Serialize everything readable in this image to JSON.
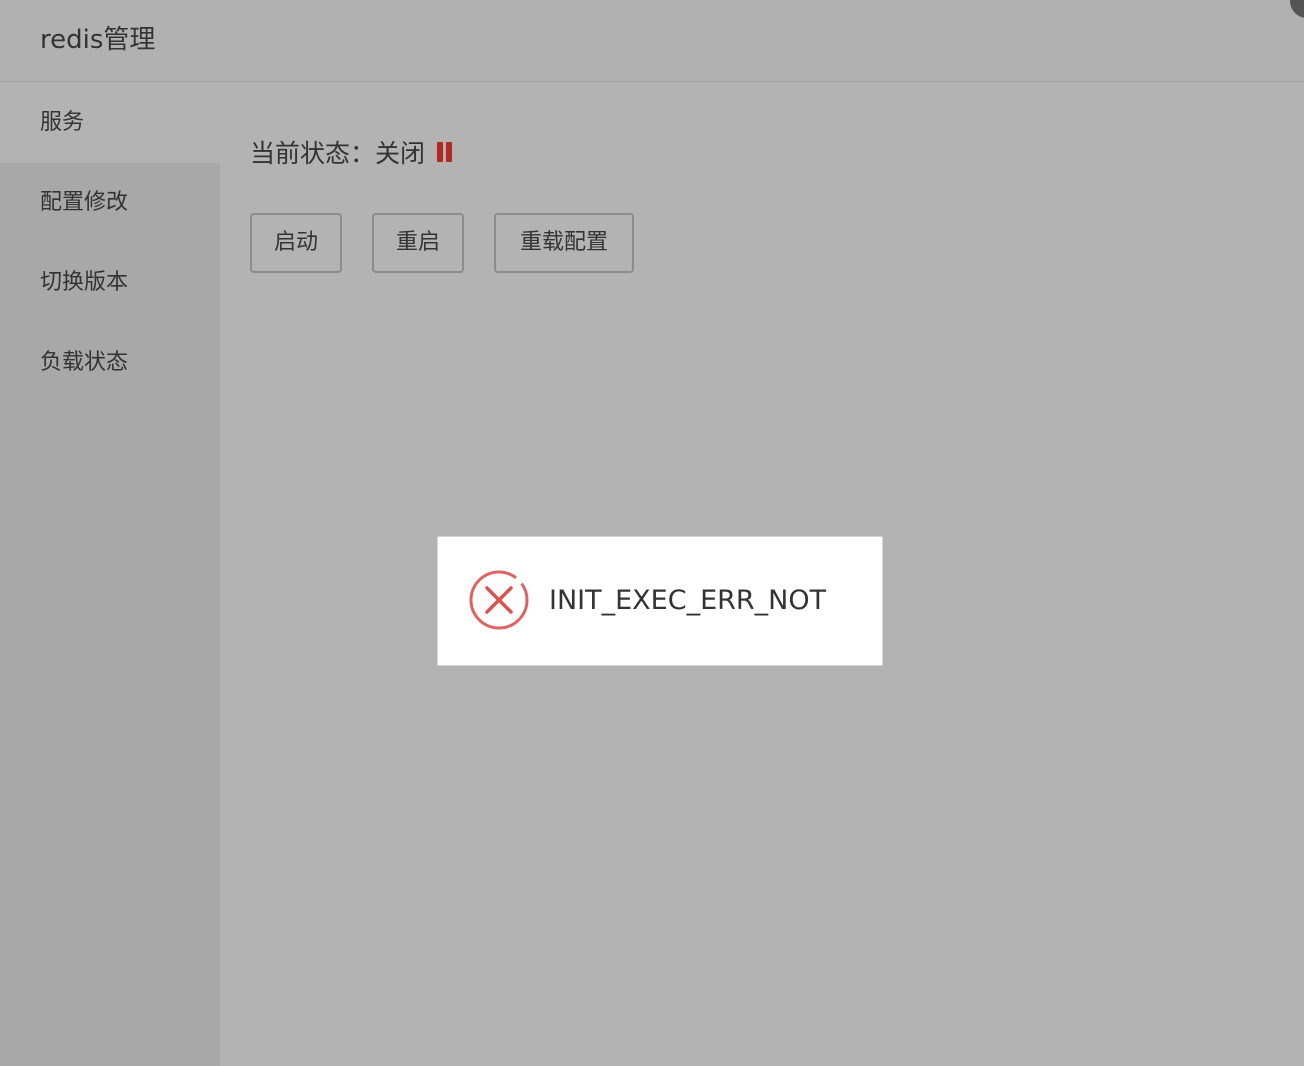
{
  "app": {
    "title": "redis管理"
  },
  "sidebar": {
    "items": [
      {
        "label": "服务",
        "active": true
      },
      {
        "label": "配置修改",
        "active": false
      },
      {
        "label": "切换版本",
        "active": false
      },
      {
        "label": "负载状态",
        "active": false
      }
    ]
  },
  "main": {
    "status_text": "当前状态：关闭",
    "status_icon": "pause-icon",
    "status_color": "#b22a1d",
    "buttons": {
      "start": "启动",
      "restart": "重启",
      "reload": "重载配置"
    }
  },
  "toast": {
    "icon": "error-circle-x-icon",
    "icon_color": "#d9534f",
    "message": "INIT_EXEC_ERR_NOT"
  }
}
